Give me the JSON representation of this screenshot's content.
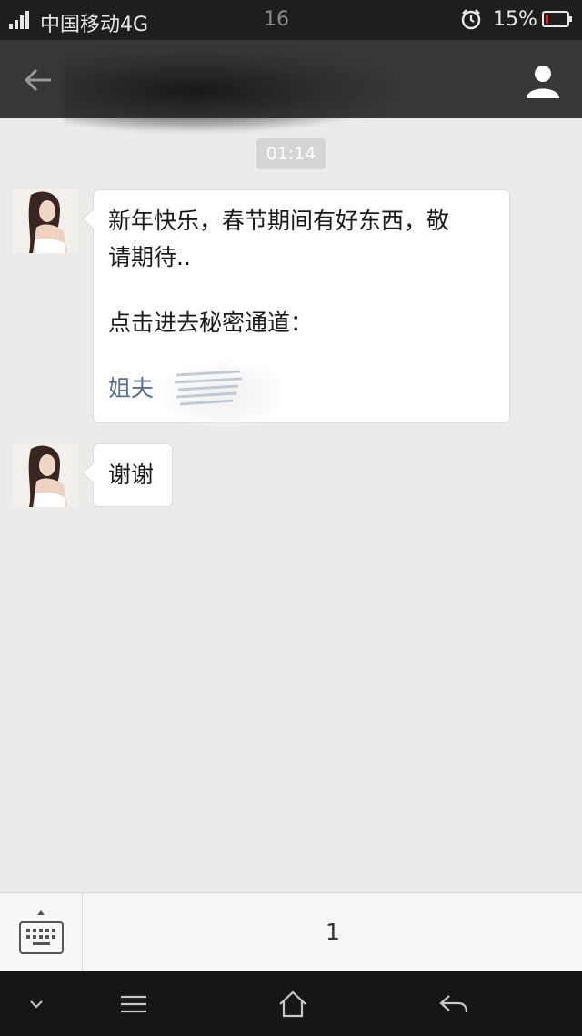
{
  "status_bar": {
    "carrier": "中国移动4G",
    "time": "16",
    "battery_percent": "15%",
    "battery_level": 0.15,
    "battery_color": "#e02020"
  },
  "title_bar": {
    "back_icon": "arrow-left-icon",
    "contact_icon": "person-icon"
  },
  "chat": {
    "timestamp": "01:14",
    "messages": [
      {
        "lines": [
          "新年快乐，春节期间有好东西，敬",
          "请期待.."
        ],
        "line2": "点击进去秘密通道：",
        "link": "姐夫"
      },
      {
        "text": "谢谢"
      }
    ]
  },
  "input_bar": {
    "keyboard_icon": "keyboard-icon",
    "menu_label": "1"
  },
  "nav_bar": {
    "icons": [
      "chevron-down-icon",
      "menu-icon",
      "home-icon",
      "back-icon"
    ]
  }
}
